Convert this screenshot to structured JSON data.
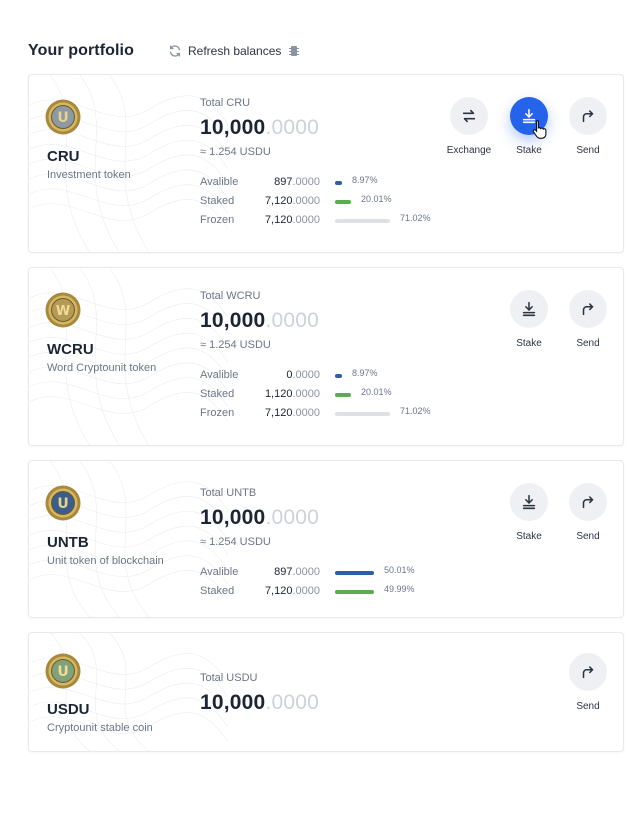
{
  "header": {
    "title": "Your portfolio",
    "refresh_label": "Refresh balances"
  },
  "colors": {
    "available": "#2f5ea8",
    "staked": "#5aad4e",
    "frozen": "#dde1e6",
    "primary": "#2563eb"
  },
  "cards": [
    {
      "symbol": "CRU",
      "description": "Investment token",
      "total_label": "Total CRU",
      "total_int": "10,000",
      "total_dec": ".0000",
      "approx": "≈ 1.254 USDU",
      "rows": [
        {
          "label": "Avalible",
          "int": "897",
          "dec": ".0000",
          "pct": "8.97%",
          "fraction": 0.0897
        },
        {
          "label": "Staked",
          "int": "7,120",
          "dec": ".0000",
          "pct": "20.01%",
          "fraction": 0.2001
        },
        {
          "label": "Frozen",
          "int": "7,120",
          "dec": ".0000",
          "pct": "71.02%",
          "fraction": 0.7102
        }
      ],
      "actions": [
        "Exchange",
        "Stake",
        "Send"
      ]
    },
    {
      "symbol": "WCRU",
      "description": "Word Cryptounit token",
      "total_label": "Total WCRU",
      "total_int": "10,000",
      "total_dec": ".0000",
      "approx": "≈ 1.254 USDU",
      "rows": [
        {
          "label": "Avalible",
          "int": "0",
          "dec": ".0000",
          "pct": "8.97%",
          "fraction": 0.0897
        },
        {
          "label": "Staked",
          "int": "1,120",
          "dec": ".0000",
          "pct": "20.01%",
          "fraction": 0.2001
        },
        {
          "label": "Frozen",
          "int": "7,120",
          "dec": ".0000",
          "pct": "71.02%",
          "fraction": 0.7102
        }
      ],
      "actions": [
        "Stake",
        "Send"
      ]
    },
    {
      "symbol": "UNTB",
      "description": "Unit token of blockchain",
      "total_label": "Total UNTB",
      "total_int": "10,000",
      "total_dec": ".0000",
      "approx": "≈ 1.254 USDU",
      "rows": [
        {
          "label": "Avalible",
          "int": "897",
          "dec": ".0000",
          "pct": "50.01%",
          "fraction": 0.5001
        },
        {
          "label": "Staked",
          "int": "7,120",
          "dec": ".0000",
          "pct": "49.99%",
          "fraction": 0.4999
        }
      ],
      "actions": [
        "Stake",
        "Send"
      ]
    },
    {
      "symbol": "USDU",
      "description": "Cryptounit stable coin",
      "total_label": "Total USDU",
      "total_int": "10,000",
      "total_dec": ".0000",
      "actions": [
        "Send"
      ]
    }
  ]
}
